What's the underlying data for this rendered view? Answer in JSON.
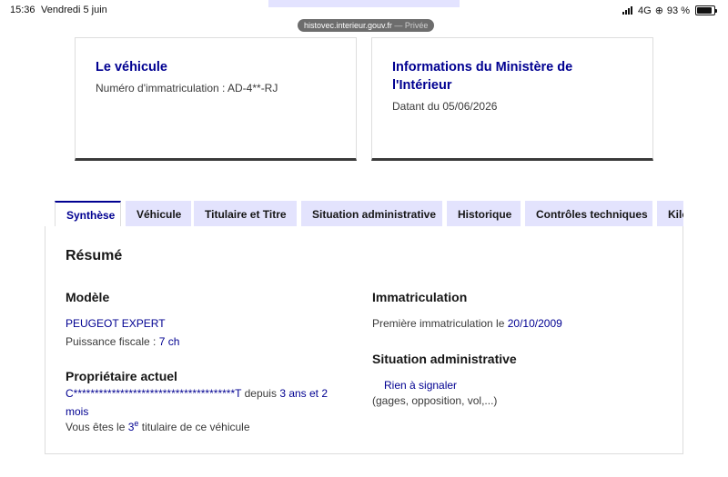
{
  "status_bar": {
    "time": "15:36",
    "date": "Vendredi 5 juin",
    "network": "4G",
    "battery": "93 %"
  },
  "browser": {
    "url": "histovec.interieur.gouv.fr",
    "private_label": "— Privée"
  },
  "cards": {
    "vehicle": {
      "title": "Le véhicule",
      "registration": "Numéro d'immatriculation : AD-4**-RJ"
    },
    "ministry": {
      "title_line1": "Informations du Ministère de",
      "title_line2": "l'Intérieur",
      "date": "Datant du 05/06/2026"
    }
  },
  "tabs": [
    "Synthèse",
    "Véhicule",
    "Titulaire et Titre",
    "Situation administrative",
    "Historique",
    "Contrôles techniques",
    "Kilométrage"
  ],
  "summary": {
    "title": "Résumé",
    "model": {
      "heading": "Modèle",
      "name": "PEUGEOT EXPERT",
      "power_label": "Puissance fiscale :",
      "power_value": "7 ch"
    },
    "owner": {
      "heading": "Propriétaire actuel",
      "name": "C**************************************T",
      "since_label": "depuis",
      "since_value_line1": "3 ans et 2",
      "since_value_line2": "mois",
      "rank_prefix": "Vous êtes le",
      "rank_number": "3",
      "rank_sup": "e",
      "rank_suffix": "titulaire de ce véhicule"
    },
    "registration": {
      "heading": "Immatriculation",
      "label": "Première immatriculation le",
      "date": "20/10/2009"
    },
    "admin": {
      "heading": "Situation administrative",
      "status": "Rien à signaler",
      "detail": "(gages, opposition, vol,...)"
    }
  }
}
